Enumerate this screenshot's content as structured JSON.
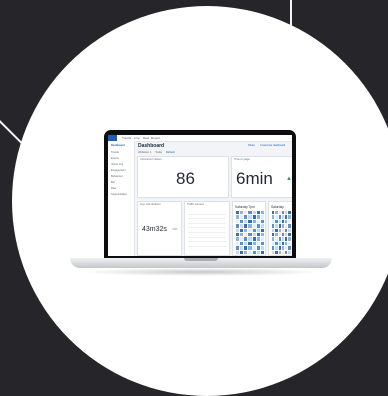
{
  "dashboard": {
    "page_title": "Dashboard",
    "nav_tabs": [
      "Trends",
      "Live",
      "Raw",
      "Report"
    ],
    "sidebar_items": [
      "Dashboard",
      "Trends",
      "Events",
      "Visitor Log",
      "Engagement",
      "Behaviour",
      "Bot",
      "Raw",
      "Segmentation"
    ],
    "filters": [
      "Websites: 1",
      "Today",
      "Refresh"
    ],
    "header_links": [
      "Share",
      "Customise dashboard"
    ],
    "metrics": [
      {
        "label": "Concurrent visitors",
        "value": "86"
      },
      {
        "label": "Time on page",
        "value": "6min",
        "trend": "up"
      },
      {
        "label": "Avg. visit duration",
        "value": "43m32s",
        "trend": "up",
        "delta": "+5%"
      },
      {
        "label": "Traffic sources",
        "value": ""
      },
      {
        "label": "Visitors by hour",
        "value": "Saturday 7pm"
      },
      {
        "label": "Visitors by hour",
        "value": "Saturday"
      }
    ],
    "accent": "#1e5fb4",
    "positive": "#2e9a48"
  }
}
